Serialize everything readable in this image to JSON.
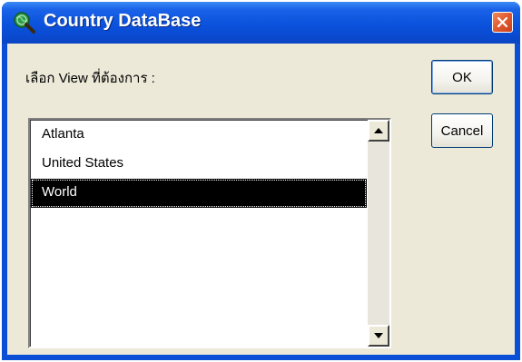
{
  "window": {
    "title": "Country DataBase",
    "prompt": "เลือก View ที่ต้องการ :"
  },
  "buttons": {
    "ok_label": "OK",
    "cancel_label": "Cancel"
  },
  "list": {
    "items": [
      "Atlanta",
      "United States",
      "World"
    ],
    "selected_value": "World"
  },
  "icons": {
    "app": "globe-magnifier-icon",
    "close": "close-icon",
    "scroll_up": "scroll-up-arrow-icon",
    "scroll_down": "scroll-down-arrow-icon"
  },
  "colors": {
    "titlebar": "#0b52dc",
    "client": "#ece9d8",
    "selection": "#000000",
    "close_button": "#e0592e"
  }
}
